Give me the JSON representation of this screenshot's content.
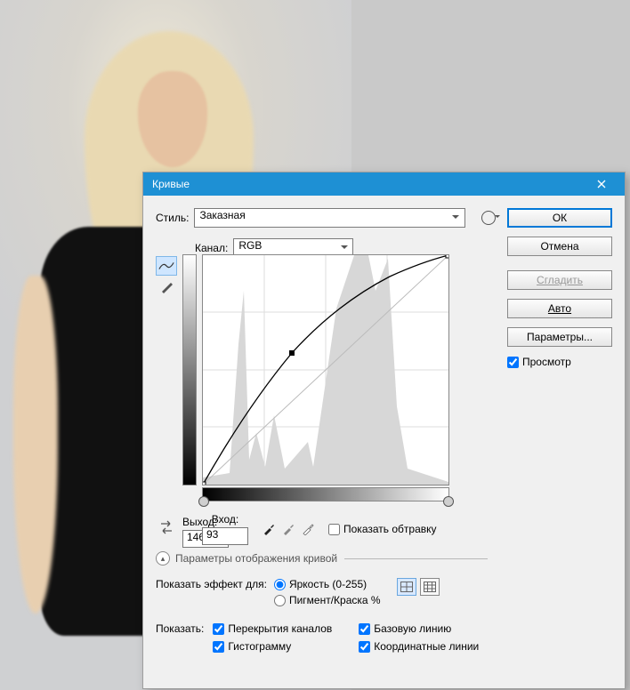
{
  "dialog": {
    "title": "Кривые",
    "style_label": "Стиль:",
    "style_value": "Заказная",
    "channel_label": "Канал:",
    "channel_value": "RGB",
    "output_label": "Выход:",
    "output_value": "146",
    "input_label": "Вход:",
    "input_value": "93",
    "show_clipping_label": "Показать обтравку",
    "display_header": "Параметры отображения кривой",
    "show_effect_label": "Показать эффект для:",
    "mode_brightness": "Яркость (0-255)",
    "mode_pigment": "Пигмент/Краска %",
    "show_label": "Показать:",
    "opt_overlays": "Перекрытия каналов",
    "opt_hist": "Гистограмму",
    "opt_baseline": "Базовую линию",
    "opt_gridlines": "Координатные линии"
  },
  "buttons": {
    "ok": "ОК",
    "cancel": "Отмена",
    "smooth": "Сгладить",
    "auto": "Авто",
    "options": "Параметры...",
    "preview": "Просмотр"
  },
  "icons": {
    "gear": "gear-icon",
    "curve_tool": "curve-tool-icon",
    "pencil_tool": "pencil-tool-icon",
    "swap": "swap-axes-icon",
    "dropper_black": "black-point-eyedropper-icon",
    "dropper_gray": "gray-point-eyedropper-icon",
    "dropper_white": "white-point-eyedropper-icon",
    "grid_small": "grid-small-icon",
    "grid_large": "grid-large-icon",
    "chev": "chevron-up-icon",
    "close": "close-icon"
  },
  "chart_data": {
    "type": "line",
    "title": "",
    "xlabel": "Вход",
    "ylabel": "Выход",
    "xlim": [
      0,
      255
    ],
    "ylim": [
      0,
      255
    ],
    "grid": true,
    "series": [
      {
        "name": "curve",
        "x": [
          0,
          20,
          40,
          60,
          80,
          93,
          120,
          160,
          200,
          240,
          255
        ],
        "values": [
          0,
          40,
          78,
          110,
          132,
          146,
          170,
          200,
          224,
          246,
          255
        ]
      },
      {
        "name": "baseline",
        "x": [
          0,
          255
        ],
        "values": [
          0,
          255
        ]
      }
    ],
    "control_points": [
      {
        "x": 0,
        "y": 0
      },
      {
        "x": 93,
        "y": 146
      },
      {
        "x": 255,
        "y": 255
      }
    ],
    "histogram_hint_peaks_x": [
      42,
      62,
      82,
      112,
      148,
      175,
      180,
      185,
      206
    ]
  }
}
